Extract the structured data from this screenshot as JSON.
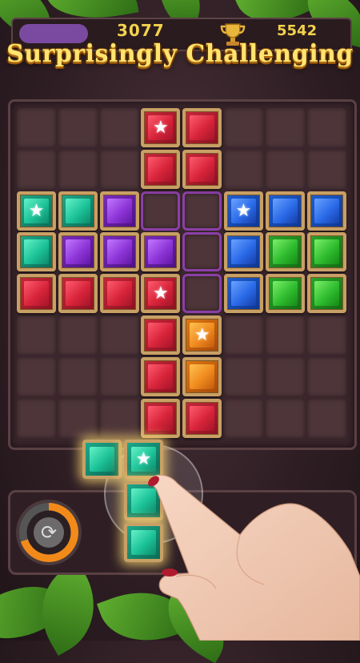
{
  "hud": {
    "score": "3077",
    "best": "5542"
  },
  "banner": {
    "title": "Surprisingly Challenging"
  },
  "board": {
    "rows": 8,
    "cols": 8,
    "gems": [
      {
        "r": 0,
        "c": 3,
        "color": "red",
        "star": true
      },
      {
        "r": 0,
        "c": 4,
        "color": "red",
        "star": false
      },
      {
        "r": 1,
        "c": 3,
        "color": "red",
        "star": false
      },
      {
        "r": 1,
        "c": 4,
        "color": "red",
        "star": false
      },
      {
        "r": 2,
        "c": 0,
        "color": "teal",
        "star": true
      },
      {
        "r": 2,
        "c": 1,
        "color": "teal",
        "star": false
      },
      {
        "r": 2,
        "c": 2,
        "color": "purple",
        "star": false
      },
      {
        "r": 2,
        "c": 5,
        "color": "blue",
        "star": true
      },
      {
        "r": 2,
        "c": 6,
        "color": "blue",
        "star": false
      },
      {
        "r": 2,
        "c": 7,
        "color": "blue",
        "star": false
      },
      {
        "r": 3,
        "c": 0,
        "color": "teal",
        "star": false
      },
      {
        "r": 3,
        "c": 1,
        "color": "purple",
        "star": false
      },
      {
        "r": 3,
        "c": 2,
        "color": "purple",
        "star": false
      },
      {
        "r": 3,
        "c": 3,
        "color": "purple",
        "star": false
      },
      {
        "r": 3,
        "c": 5,
        "color": "blue",
        "star": false
      },
      {
        "r": 3,
        "c": 6,
        "color": "green",
        "star": false
      },
      {
        "r": 3,
        "c": 7,
        "color": "green",
        "star": false
      },
      {
        "r": 4,
        "c": 0,
        "color": "red",
        "star": false
      },
      {
        "r": 4,
        "c": 1,
        "color": "red",
        "star": false
      },
      {
        "r": 4,
        "c": 2,
        "color": "red",
        "star": false
      },
      {
        "r": 4,
        "c": 3,
        "color": "red",
        "star": true
      },
      {
        "r": 4,
        "c": 5,
        "color": "blue",
        "star": false
      },
      {
        "r": 4,
        "c": 6,
        "color": "green",
        "star": false
      },
      {
        "r": 4,
        "c": 7,
        "color": "green",
        "star": false
      },
      {
        "r": 5,
        "c": 3,
        "color": "red",
        "star": false
      },
      {
        "r": 5,
        "c": 4,
        "color": "orange",
        "star": true
      },
      {
        "r": 6,
        "c": 3,
        "color": "red",
        "star": false
      },
      {
        "r": 6,
        "c": 4,
        "color": "orange",
        "star": false
      },
      {
        "r": 7,
        "c": 3,
        "color": "red",
        "star": false
      },
      {
        "r": 7,
        "c": 4,
        "color": "red",
        "star": false
      }
    ],
    "hints": [
      {
        "r": 2,
        "c": 3
      },
      {
        "r": 2,
        "c": 4
      },
      {
        "r": 3,
        "c": 4
      },
      {
        "r": 4,
        "c": 4
      }
    ]
  },
  "dragged_piece": {
    "color": "teal",
    "cells": [
      {
        "r": 0,
        "c": 0,
        "star": false
      },
      {
        "r": 0,
        "c": 1,
        "star": true
      },
      {
        "r": 1,
        "c": 1,
        "star": false
      },
      {
        "r": 2,
        "c": 1,
        "star": false
      }
    ]
  },
  "rotate_button": {
    "icon": "rotate-icon",
    "progress": 0.7
  },
  "colors": {
    "banner": "#ffe470",
    "score": "#f3d24c",
    "hint_outline": "#8b3fa8"
  }
}
